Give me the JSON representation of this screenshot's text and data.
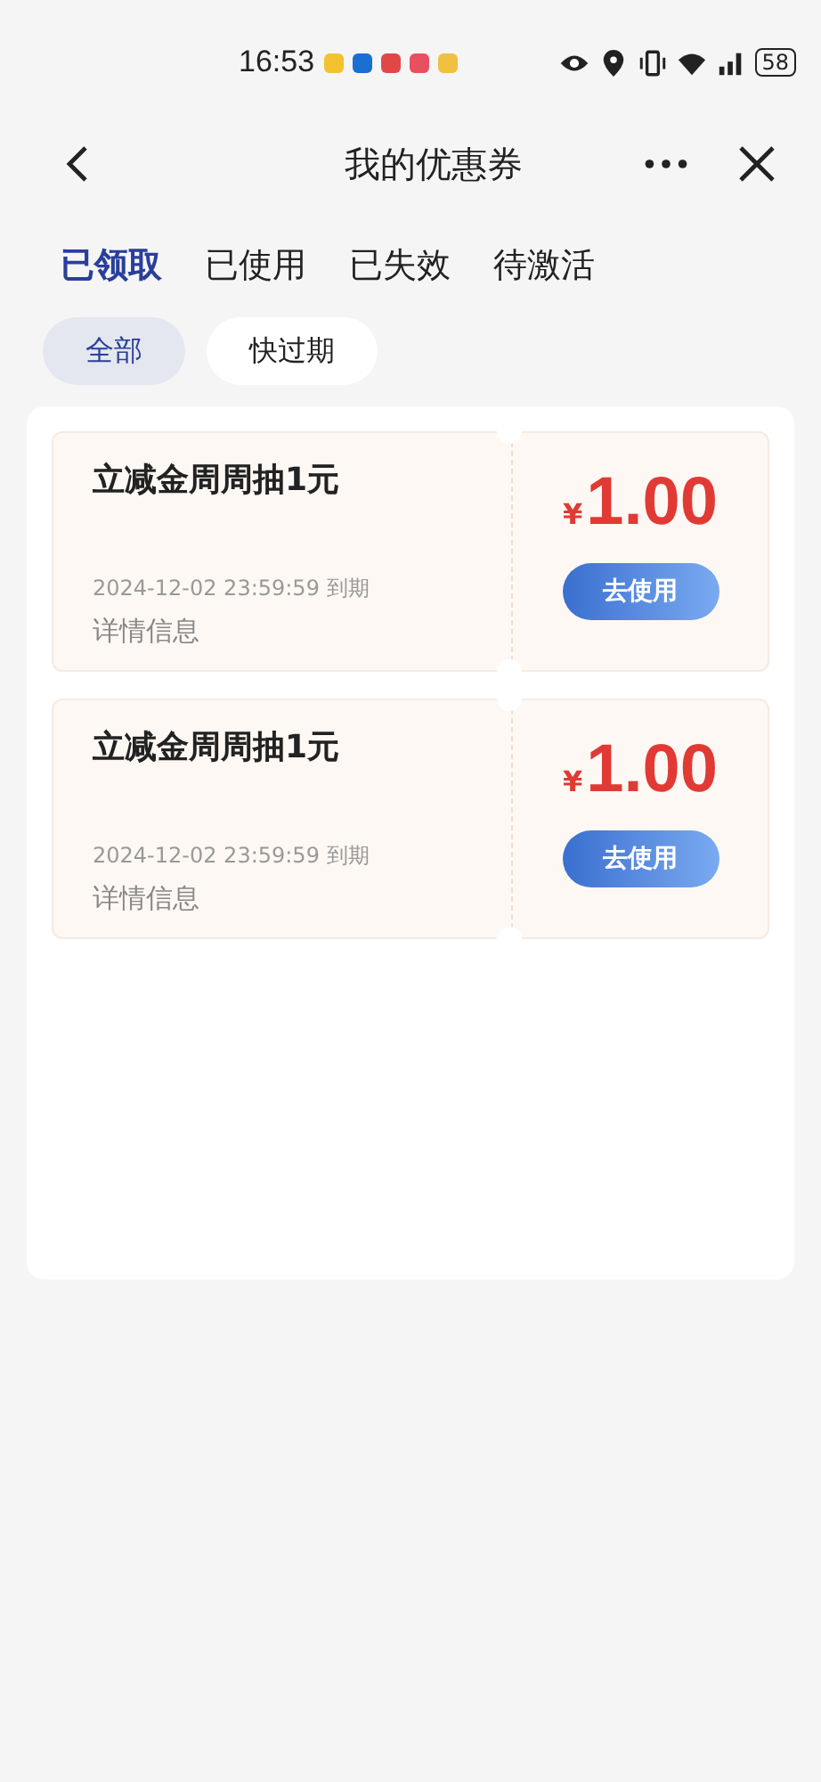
{
  "status_bar": {
    "time": "16:53",
    "battery": "58"
  },
  "nav": {
    "title": "我的优惠券"
  },
  "tabs": [
    {
      "label": "已领取",
      "selected": true
    },
    {
      "label": "已使用",
      "selected": false
    },
    {
      "label": "已失效",
      "selected": false
    },
    {
      "label": "待激活",
      "selected": false
    }
  ],
  "filters": [
    {
      "label": "全部",
      "selected": true
    },
    {
      "label": "快过期",
      "selected": false
    }
  ],
  "coupons": [
    {
      "title": "立减金周周抽1元",
      "expiry": "2024-12-02 23:59:59 到期",
      "details": "详情信息",
      "currency": "¥",
      "amount": "1.00",
      "action": "去使用"
    },
    {
      "title": "立减金周周抽1元",
      "expiry": "2024-12-02 23:59:59 到期",
      "details": "详情信息",
      "currency": "¥",
      "amount": "1.00",
      "action": "去使用"
    }
  ]
}
